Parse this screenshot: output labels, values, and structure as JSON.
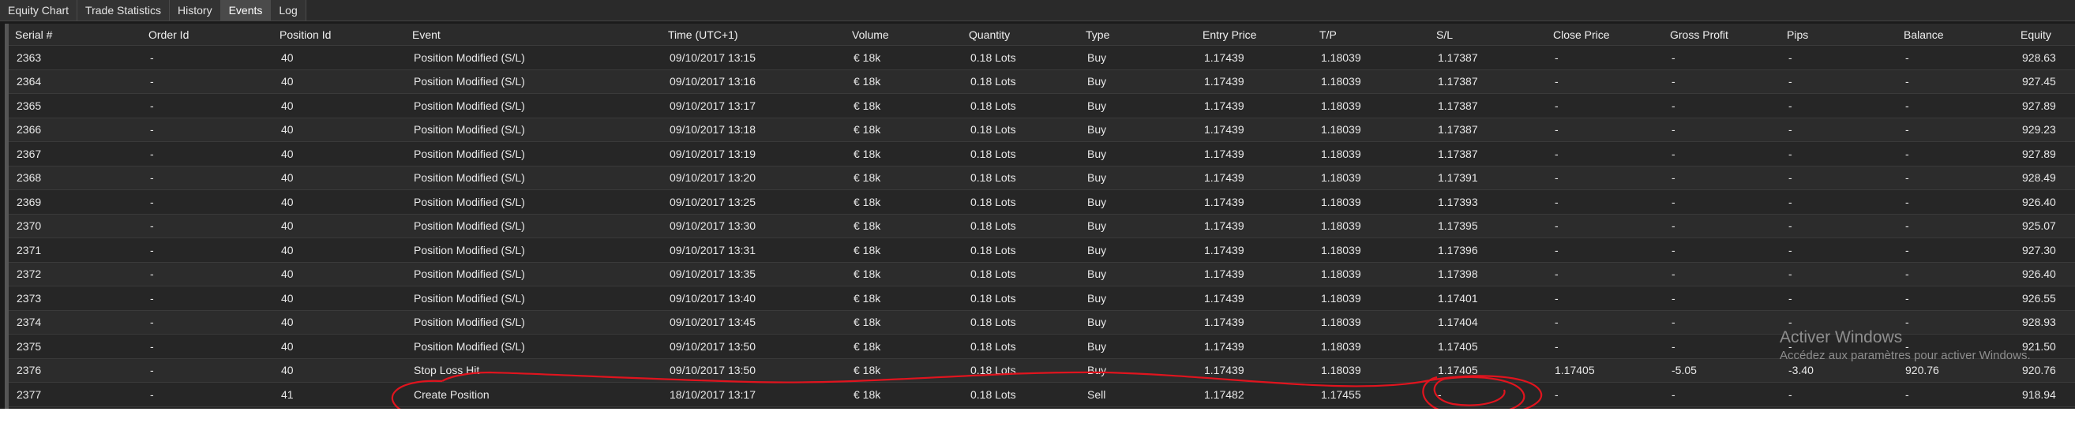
{
  "tabs": [
    {
      "label": "Equity Chart",
      "active": false
    },
    {
      "label": "Trade Statistics",
      "active": false
    },
    {
      "label": "History",
      "active": false
    },
    {
      "label": "Events",
      "active": true
    },
    {
      "label": "Log",
      "active": false
    }
  ],
  "table": {
    "columns": [
      "Serial #",
      "Order Id",
      "Position Id",
      "Event",
      "Time (UTC+1)",
      "Volume",
      "Quantity",
      "Type",
      "Entry Price",
      "T/P",
      "S/L",
      "Close Price",
      "Gross Profit",
      "Pips",
      "Balance",
      "Equity"
    ],
    "rows": [
      [
        "2363",
        "-",
        "40",
        "Position Modified (S/L)",
        "09/10/2017 13:15",
        "€ 18k",
        "0.18 Lots",
        "Buy",
        "1.17439",
        "1.18039",
        "1.17387",
        "-",
        "-",
        "-",
        "-",
        "928.63"
      ],
      [
        "2364",
        "-",
        "40",
        "Position Modified (S/L)",
        "09/10/2017 13:16",
        "€ 18k",
        "0.18 Lots",
        "Buy",
        "1.17439",
        "1.18039",
        "1.17387",
        "-",
        "-",
        "-",
        "-",
        "927.45"
      ],
      [
        "2365",
        "-",
        "40",
        "Position Modified (S/L)",
        "09/10/2017 13:17",
        "€ 18k",
        "0.18 Lots",
        "Buy",
        "1.17439",
        "1.18039",
        "1.17387",
        "-",
        "-",
        "-",
        "-",
        "927.89"
      ],
      [
        "2366",
        "-",
        "40",
        "Position Modified (S/L)",
        "09/10/2017 13:18",
        "€ 18k",
        "0.18 Lots",
        "Buy",
        "1.17439",
        "1.18039",
        "1.17387",
        "-",
        "-",
        "-",
        "-",
        "929.23"
      ],
      [
        "2367",
        "-",
        "40",
        "Position Modified (S/L)",
        "09/10/2017 13:19",
        "€ 18k",
        "0.18 Lots",
        "Buy",
        "1.17439",
        "1.18039",
        "1.17387",
        "-",
        "-",
        "-",
        "-",
        "927.89"
      ],
      [
        "2368",
        "-",
        "40",
        "Position Modified (S/L)",
        "09/10/2017 13:20",
        "€ 18k",
        "0.18 Lots",
        "Buy",
        "1.17439",
        "1.18039",
        "1.17391",
        "-",
        "-",
        "-",
        "-",
        "928.49"
      ],
      [
        "2369",
        "-",
        "40",
        "Position Modified (S/L)",
        "09/10/2017 13:25",
        "€ 18k",
        "0.18 Lots",
        "Buy",
        "1.17439",
        "1.18039",
        "1.17393",
        "-",
        "-",
        "-",
        "-",
        "926.40"
      ],
      [
        "2370",
        "-",
        "40",
        "Position Modified (S/L)",
        "09/10/2017 13:30",
        "€ 18k",
        "0.18 Lots",
        "Buy",
        "1.17439",
        "1.18039",
        "1.17395",
        "-",
        "-",
        "-",
        "-",
        "925.07"
      ],
      [
        "2371",
        "-",
        "40",
        "Position Modified (S/L)",
        "09/10/2017 13:31",
        "€ 18k",
        "0.18 Lots",
        "Buy",
        "1.17439",
        "1.18039",
        "1.17396",
        "-",
        "-",
        "-",
        "-",
        "927.30"
      ],
      [
        "2372",
        "-",
        "40",
        "Position Modified (S/L)",
        "09/10/2017 13:35",
        "€ 18k",
        "0.18 Lots",
        "Buy",
        "1.17439",
        "1.18039",
        "1.17398",
        "-",
        "-",
        "-",
        "-",
        "926.40"
      ],
      [
        "2373",
        "-",
        "40",
        "Position Modified (S/L)",
        "09/10/2017 13:40",
        "€ 18k",
        "0.18 Lots",
        "Buy",
        "1.17439",
        "1.18039",
        "1.17401",
        "-",
        "-",
        "-",
        "-",
        "926.55"
      ],
      [
        "2374",
        "-",
        "40",
        "Position Modified (S/L)",
        "09/10/2017 13:45",
        "€ 18k",
        "0.18 Lots",
        "Buy",
        "1.17439",
        "1.18039",
        "1.17404",
        "-",
        "-",
        "-",
        "-",
        "928.93"
      ],
      [
        "2375",
        "-",
        "40",
        "Position Modified (S/L)",
        "09/10/2017 13:50",
        "€ 18k",
        "0.18 Lots",
        "Buy",
        "1.17439",
        "1.18039",
        "1.17405",
        "-",
        "-",
        "-",
        "-",
        "921.50"
      ],
      [
        "2376",
        "-",
        "40",
        "Stop Loss Hit",
        "09/10/2017 13:50",
        "€ 18k",
        "0.18 Lots",
        "Buy",
        "1.17439",
        "1.18039",
        "1.17405",
        "1.17405",
        "-5.05",
        "-3.40",
        "920.76",
        "920.76"
      ],
      [
        "2377",
        "-",
        "41",
        "Create Position",
        "18/10/2017 13:17",
        "€ 18k",
        "0.18 Lots",
        "Sell",
        "1.17482",
        "1.17455",
        "-",
        "-",
        "-",
        "-",
        "-",
        "918.94"
      ]
    ]
  },
  "watermark": {
    "title": "Activer Windows",
    "subtitle": "Accédez aux paramètres pour activer Windows."
  },
  "colors": {
    "background": "#1b1b1b",
    "active_tab": "#4a4a4a",
    "annotation": "#e0141e"
  }
}
